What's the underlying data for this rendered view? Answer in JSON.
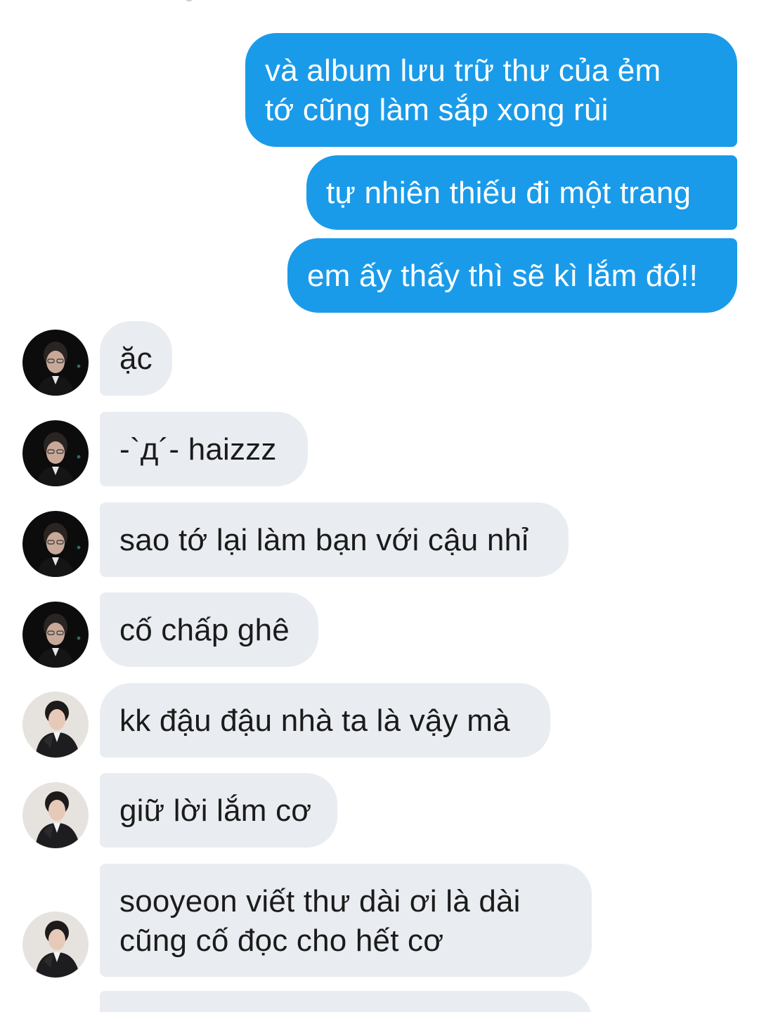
{
  "messages": {
    "sent": [
      "và album lưu trữ thư của ẻm\ntớ cũng làm sắp xong rùi",
      "tự nhiên thiếu đi một trang",
      "em ấy thấy thì sẽ kì lắm đó!!"
    ],
    "received": [
      {
        "sender": "avatar-dark",
        "text": "ặc"
      },
      {
        "sender": "avatar-dark",
        "text": "-`д´-  haizzz"
      },
      {
        "sender": "avatar-dark",
        "text": "sao tớ lại làm bạn với cậu nhỉ"
      },
      {
        "sender": "avatar-dark",
        "text": "cố chấp ghê"
      },
      {
        "sender": "avatar-light",
        "text": "kk đậu đậu nhà ta là vậy mà"
      },
      {
        "sender": "avatar-light",
        "text": "giữ lời lắm cơ"
      },
      {
        "sender": "avatar-light",
        "text": "sooyeon viết thư dài ơi là dài\ncũng cố đọc cho hết cơ"
      }
    ]
  },
  "colors": {
    "sent_bubble": "#1a9bea",
    "received_bubble": "#e9ecf0",
    "background": "#ffffff"
  }
}
